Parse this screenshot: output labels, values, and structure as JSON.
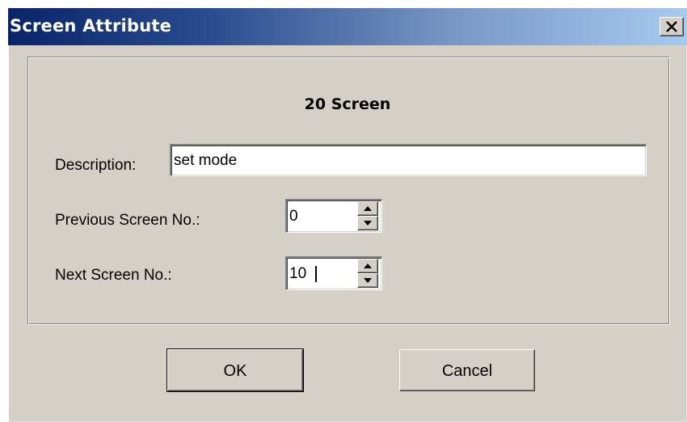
{
  "window": {
    "title": "Screen Attribute",
    "close_icon": "close-icon"
  },
  "form": {
    "heading": "20 Screen",
    "description": {
      "label": "Description:",
      "value": "set mode"
    },
    "previous_screen": {
      "label": "Previous Screen No.:",
      "value": "0"
    },
    "next_screen": {
      "label": "Next Screen No.:",
      "value": "10"
    }
  },
  "buttons": {
    "ok_label": "OK",
    "cancel_label": "Cancel"
  },
  "colors": {
    "title_gradient_start": "#0a246a",
    "title_gradient_end": "#a6caf0",
    "dialog_face": "#d4d0c8"
  }
}
